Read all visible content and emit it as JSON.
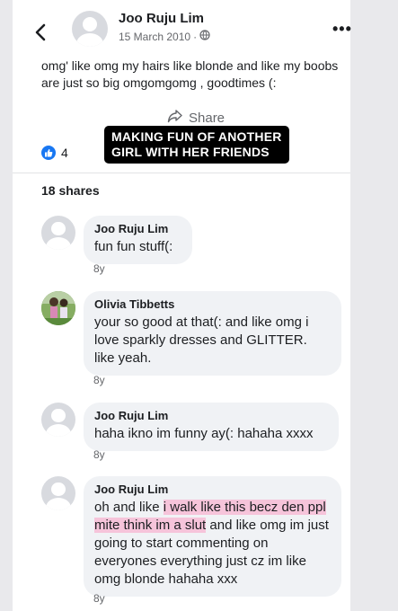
{
  "post": {
    "author": "Joo Ruju Lim",
    "date": "15 March 2010",
    "text": "omg' like omg my hairs like blonde and like my boobs are just so big omgomgomg , goodtimes (:",
    "share_label": "Share",
    "like_count": "4",
    "shares_label": "18 shares"
  },
  "caption": "MAKING FUN OF ANOTHER\nGIRL WITH HER FRIENDS",
  "icons": {
    "back": "chevron-left-icon",
    "audience": "globe-icon",
    "more": "more-icon",
    "share": "share-icon",
    "like": "thumbs-up-icon"
  },
  "colors": {
    "like_blue": "#1877f2",
    "highlight": "#f6c4da",
    "bubble": "#f0f2f5"
  },
  "comments": [
    {
      "name": "Joo Ruju Lim",
      "text": "fun fun stuff(:",
      "time": "8y"
    },
    {
      "name": "Olivia Tibbetts",
      "text": "your so good at that(:  and like omg i love sparkly dresses and GLITTER. like yeah.",
      "time": "8y"
    },
    {
      "name": "Joo Ruju Lim",
      "text": "haha ikno im funny ay(: hahaha xxxx",
      "time": "8y"
    },
    {
      "name": "Joo Ruju Lim",
      "text_before": "oh and like ",
      "text_highlight": "i walk like this becz den ppl mite think im a slut",
      "text_after": " and like omg im just going to start commenting on everyones everything just cz im like omg blonde hahaha xxx",
      "time": "8y"
    }
  ]
}
